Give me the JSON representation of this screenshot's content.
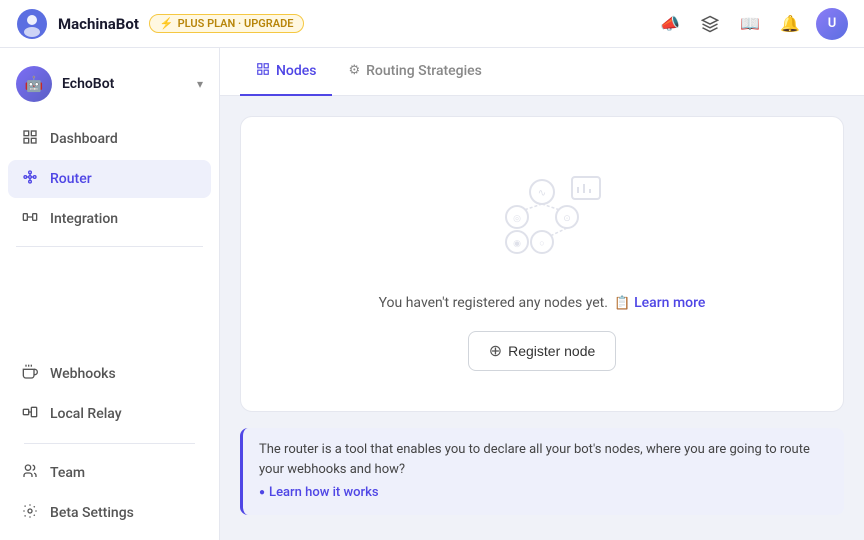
{
  "app": {
    "brand": "MachinaBot",
    "plan_badge": "PLUS PLAN · UPGRADE"
  },
  "topnav": {
    "icons": [
      "megaphone",
      "cube",
      "book",
      "bell"
    ],
    "avatar_initials": "U"
  },
  "sidebar": {
    "bot": {
      "name": "EchoBot",
      "icon": "🤖"
    },
    "nav_items": [
      {
        "id": "dashboard",
        "label": "Dashboard",
        "icon": "dashboard"
      },
      {
        "id": "router",
        "label": "Router",
        "icon": "router",
        "active": true
      },
      {
        "id": "integration",
        "label": "Integration",
        "icon": "integration"
      }
    ],
    "bottom_items": [
      {
        "id": "webhooks",
        "label": "Webhooks",
        "icon": "webhooks"
      },
      {
        "id": "local-relay",
        "label": "Local Relay",
        "icon": "relay"
      },
      {
        "id": "team",
        "label": "Team",
        "icon": "team"
      },
      {
        "id": "beta-settings",
        "label": "Beta Settings",
        "icon": "settings"
      }
    ]
  },
  "tabs": [
    {
      "id": "nodes",
      "label": "Nodes",
      "icon": "grid",
      "active": true
    },
    {
      "id": "routing-strategies",
      "label": "Routing Strategies",
      "icon": "gear",
      "active": false
    }
  ],
  "empty_state": {
    "message": "You haven't registered any nodes yet.",
    "learn_more_label": "Learn more",
    "register_button_label": "Register node"
  },
  "info_banner": {
    "text": "The router is a tool that enables you to declare all your bot's nodes, where you are going to route your webhooks and how?",
    "learn_how_label": "Learn how it works"
  },
  "colors": {
    "accent": "#4f46e5",
    "accent_light": "#eef0fb",
    "border": "#e5e7ef",
    "text_muted": "#888",
    "text_main": "#1a1a2e"
  }
}
